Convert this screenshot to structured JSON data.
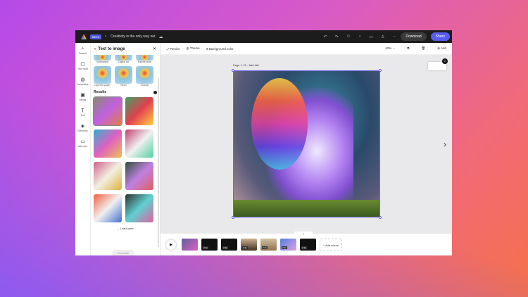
{
  "app": {
    "beta": "BETA",
    "title": "Creativity is the only way out",
    "download": "Download",
    "share": "Share"
  },
  "rail": [
    {
      "icon": "search-icon",
      "g": "⌕",
      "label": "Search"
    },
    {
      "icon": "folder-icon",
      "g": "▢",
      "label": "Your stuff"
    },
    {
      "icon": "templates-icon",
      "g": "◍",
      "label": "Templates"
    },
    {
      "icon": "media-icon",
      "g": "▣",
      "label": "Media"
    },
    {
      "icon": "text-icon",
      "g": "T",
      "label": "Text"
    },
    {
      "icon": "elements-icon",
      "g": "◈",
      "label": "Elements"
    },
    {
      "icon": "addons-icon",
      "g": "▭",
      "label": "Add-ons"
    }
  ],
  "panel": {
    "title": "Text to image",
    "styles": [
      "Synthwave",
      "Digital art",
      "Palette knife",
      "Layered paper",
      "Neon",
      "Chaotic"
    ],
    "results": "Results",
    "load_more": "Load more",
    "generate": "Generate"
  },
  "toolbar": {
    "resize": "Resize",
    "theme": "Theme",
    "bg": "Background color",
    "zoom": "42%",
    "add": "Add"
  },
  "canvas": {
    "page_label": "Page 1 / 3 – Add title",
    "page_count": "2"
  },
  "timeline": {
    "durations": [
      "2.3s",
      "2.3s",
      "2.3s",
      "2.3s",
      "2.3s",
      "2.3s"
    ],
    "add_scene": "+ Add scene"
  }
}
